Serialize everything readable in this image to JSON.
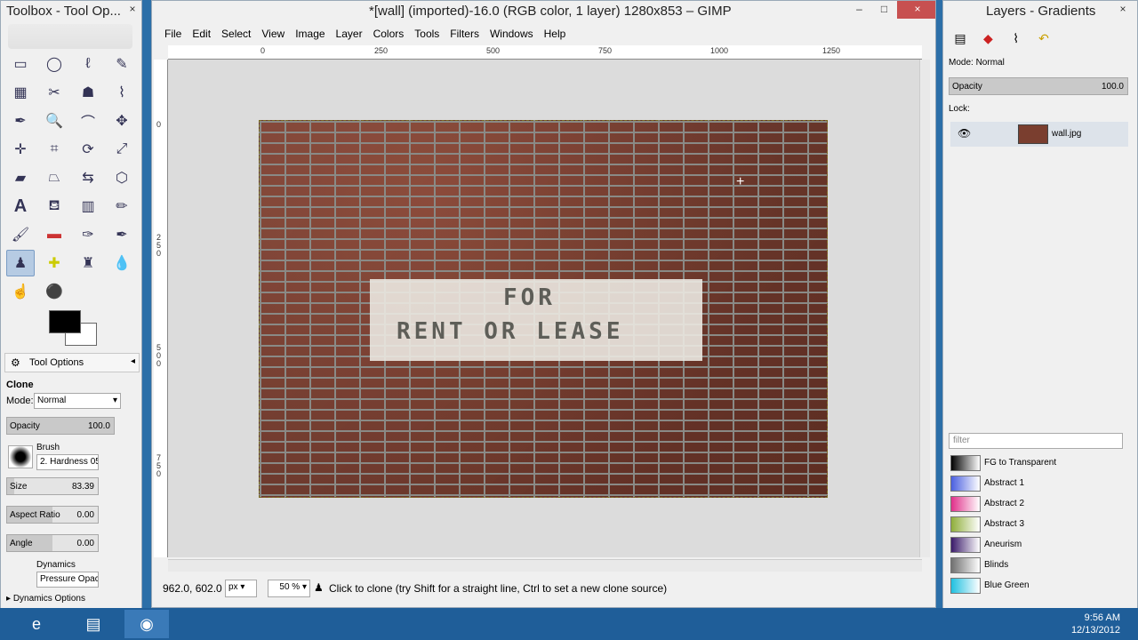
{
  "toolbox": {
    "title": "Toolbox - Tool Op...",
    "close_label": "×",
    "tool_options_tab": "Tool Options",
    "tool_name": "Clone",
    "mode_label": "Mode:",
    "mode_value": "Normal",
    "opacity_label": "Opacity",
    "opacity_value": "100.0",
    "brush_label": "Brush",
    "brush_value": "2. Hardness 05",
    "size_label": "Size",
    "size_value": "83.39",
    "aspect_label": "Aspect Ratio",
    "aspect_value": "0.00",
    "angle_label": "Angle",
    "angle_value": "0.00",
    "dynamics_label": "Dynamics",
    "dynamics_value": "Pressure Opac",
    "dynamics_options_label": "Dynamics Options"
  },
  "main": {
    "title": "*[wall] (imported)-16.0 (RGB color, 1 layer) 1280x853 – GIMP",
    "minimize": "–",
    "maximize": "□",
    "close": "×",
    "menu": [
      "File",
      "Edit",
      "Select",
      "View",
      "Image",
      "Layer",
      "Colors",
      "Tools",
      "Filters",
      "Windows",
      "Help"
    ],
    "ruler_h": [
      "0",
      "250",
      "500",
      "750",
      "1000",
      "1250"
    ],
    "ruler_v": [
      "0",
      "250",
      "500",
      "750"
    ],
    "sign_line1": "FOR",
    "sign_line2": "RENT OR LEASE",
    "status": {
      "coords": "962.0, 602.0",
      "unit": "px",
      "zoom": "50 %",
      "message": "Click to clone (try Shift for a straight line, Ctrl to set a new clone source)"
    }
  },
  "dock": {
    "title": "Layers - Gradients",
    "close_label": "×",
    "mode_label": "Mode:",
    "mode_value": "Normal",
    "opacity_label": "Opacity",
    "opacity_value": "100.0",
    "lock_label": "Lock:",
    "layer_name": "wall.jpg",
    "filter_placeholder": "filter",
    "gradients": [
      {
        "name": "FG to Transparent",
        "color": "#000000"
      },
      {
        "name": "Abstract 1",
        "color": "#4a5fe0"
      },
      {
        "name": "Abstract 2",
        "color": "#e0308a"
      },
      {
        "name": "Abstract 3",
        "color": "#8fae3a"
      },
      {
        "name": "Aneurism",
        "color": "#3a1a6a"
      },
      {
        "name": "Blinds",
        "color": "#707070"
      },
      {
        "name": "Blue Green",
        "color": "#20c0e0"
      }
    ]
  },
  "taskbar": {
    "time": "9:56 AM",
    "date": "12/13/2012"
  }
}
